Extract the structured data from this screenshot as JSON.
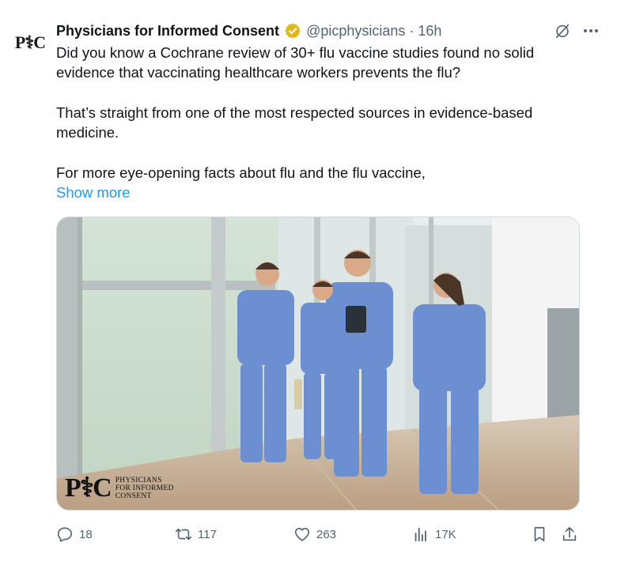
{
  "author": {
    "display_name": "Physicians for Informed Consent",
    "handle": "@picphysicians",
    "separator": "·",
    "time": "16h",
    "avatar_text": "P⚕C",
    "verified_badge_icon": "gold-verified-badge",
    "badge_color": "#e2b719"
  },
  "tweet": {
    "paragraphs": [
      "Did you know a Cochrane review of 30+ flu vaccine studies found no solid evidence that vaccinating healthcare workers prevents the flu?",
      "That’s straight from one of the most respected sources in evidence-based medicine.",
      "For more eye-opening facts about flu and the flu vaccine,"
    ],
    "show_more": "Show more"
  },
  "media": {
    "watermark_mark": "P⚕C",
    "watermark_lines": [
      "Physicians",
      "for Informed",
      "Consent"
    ]
  },
  "actions": {
    "reply": {
      "icon": "reply-icon",
      "count": "18"
    },
    "repost": {
      "icon": "repost-icon",
      "count": "117"
    },
    "like": {
      "icon": "heart-icon",
      "count": "263"
    },
    "views": {
      "icon": "views-icon",
      "count": "17K"
    },
    "bookmark": {
      "icon": "bookmark-icon"
    },
    "share": {
      "icon": "share-icon"
    }
  },
  "colors": {
    "text": "#0f1419",
    "secondary": "#536471",
    "link": "#1d9bf0",
    "scrubs": "#6b8fd1"
  }
}
